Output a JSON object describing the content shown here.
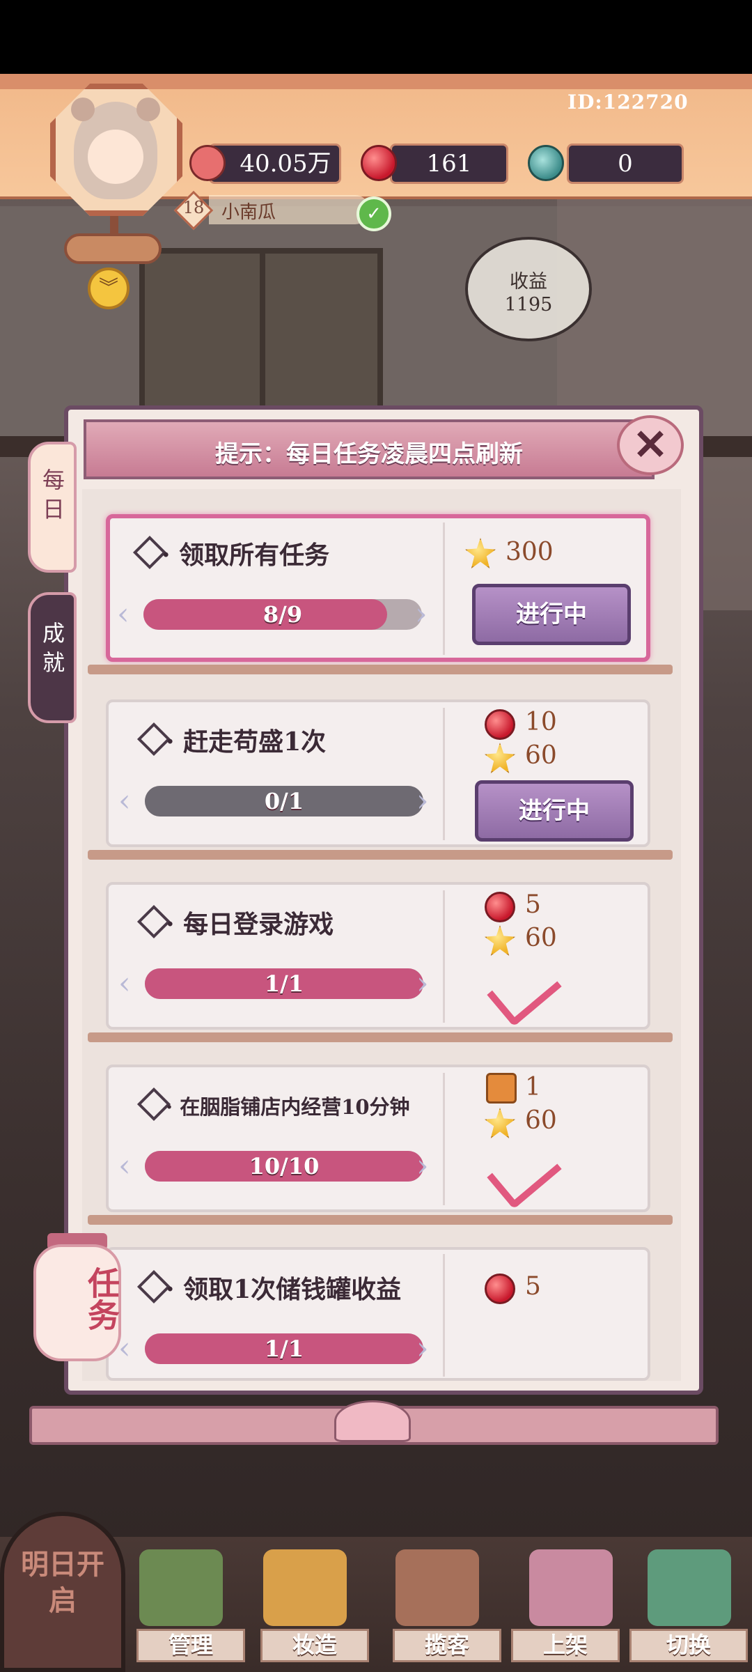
{
  "hud": {
    "player_id": "ID:122720",
    "level": "18",
    "player_name": "小南瓜",
    "resources": [
      {
        "icon": "heart-money-icon",
        "value": "40.05万"
      },
      {
        "icon": "red-gem-icon",
        "value": "161"
      },
      {
        "icon": "jade-coin-icon",
        "value": "0"
      }
    ]
  },
  "income": {
    "label": "收益",
    "value": "1195"
  },
  "panel": {
    "title": "提示：每日任务凌晨四点刷新",
    "tabs": [
      {
        "label": "每日",
        "active": true
      },
      {
        "label": "成就",
        "active": false
      }
    ],
    "tasks": [
      {
        "title": "· 领取所有任务",
        "progress_text": "8/9",
        "progress": 0.89,
        "rewards": [
          {
            "icon": "star-icon",
            "value": "300"
          }
        ],
        "status": "进行中",
        "highlight": true
      },
      {
        "title": "· 赶走苟盛1次",
        "progress_text": "0/1",
        "progress": 0,
        "rewards": [
          {
            "icon": "red-gem-icon",
            "value": "10"
          },
          {
            "icon": "star-icon",
            "value": "60"
          }
        ],
        "status": "进行中"
      },
      {
        "title": "· 每日登录游戏",
        "progress_text": "1/1",
        "progress": 1,
        "rewards": [
          {
            "icon": "red-gem-icon",
            "value": "5"
          },
          {
            "icon": "star-icon",
            "value": "60"
          }
        ],
        "status": "completed"
      },
      {
        "title": "· 在胭脂铺店内经营10分钟",
        "progress_text": "10/10",
        "progress": 1,
        "rewards": [
          {
            "icon": "scroll-ticket-icon",
            "value": "1"
          },
          {
            "icon": "star-icon",
            "value": "60"
          }
        ],
        "status": "completed"
      },
      {
        "title": "· 领取1次储钱罐收益",
        "progress_text": "1/1",
        "progress": 1,
        "rewards": [
          {
            "icon": "red-gem-icon",
            "value": "5"
          }
        ],
        "status": "completed"
      }
    ]
  },
  "lantern": {
    "label": "任务"
  },
  "bottom_nav": {
    "tomorrow_label": "明日开启",
    "items": [
      {
        "label": "管理"
      },
      {
        "label": "妆造"
      },
      {
        "label": "揽客"
      },
      {
        "label": "上架"
      },
      {
        "label": "切换"
      }
    ]
  },
  "colors": {
    "accent_pink": "#c8557e",
    "button_purple": "#8e6ba4",
    "hud_orange": "#f1b889",
    "panel_border": "#6b4b63"
  }
}
